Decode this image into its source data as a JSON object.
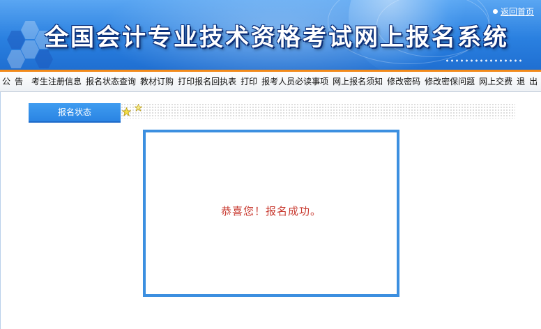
{
  "header": {
    "title": "全国会计专业技术资格考试网上报名系统",
    "back_home": "返回首页"
  },
  "nav": {
    "items": [
      "公告",
      "考生注册信息",
      "报名状态查询",
      "教材订购",
      "打印报名回执表",
      "打印",
      "报考人员必读事项",
      "网上报名须知",
      "修改密码",
      "修改密保问题",
      "网上交费",
      "退出"
    ]
  },
  "section": {
    "tab_label": "报名状态"
  },
  "message": {
    "text": "恭喜您！报名成功。"
  },
  "colors": {
    "banner": "#2a80e0",
    "nav_accent": "#f28a1a",
    "tab": "#2a84e3",
    "box_border": "#3c8fe0",
    "message_text": "#c8392f"
  }
}
